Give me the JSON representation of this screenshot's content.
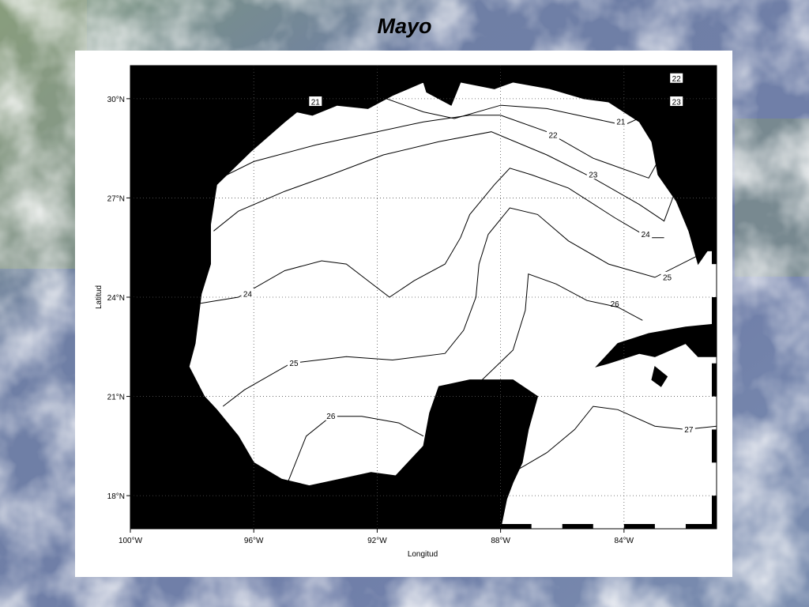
{
  "title": "Mayo",
  "colors": {
    "land": "#000000",
    "sea": "#ffffff",
    "contour": "#000000",
    "grid": "#555555"
  },
  "map": {
    "xlabel": "Longitud",
    "ylabel": "Latitud",
    "lon_range": [
      -100,
      -81
    ],
    "lat_range": [
      17,
      31
    ],
    "lon_ticks": [
      {
        "value": -100,
        "label": "100°W"
      },
      {
        "value": -96,
        "label": "96°W"
      },
      {
        "value": -92,
        "label": "92°W"
      },
      {
        "value": -88,
        "label": "88°W"
      },
      {
        "value": -84,
        "label": "84°W"
      }
    ],
    "lat_ticks": [
      {
        "value": 18,
        "label": "18°N"
      },
      {
        "value": 21,
        "label": "21°N"
      },
      {
        "value": 24,
        "label": "24°N"
      },
      {
        "value": 27,
        "label": "27°N"
      },
      {
        "value": 30,
        "label": "30°N"
      }
    ],
    "contours": [
      {
        "level": "21",
        "labels": [
          [
            -94.0,
            29.9
          ],
          [
            -84.1,
            29.3
          ]
        ],
        "points": [
          [
            -94.4,
            29.6
          ],
          [
            -93.5,
            29.8
          ],
          [
            -92.0,
            30.1
          ],
          [
            -90.5,
            29.6
          ],
          [
            -89.5,
            29.4
          ],
          [
            -88.0,
            29.8
          ],
          [
            -86.5,
            29.7
          ],
          [
            -85.5,
            29.5
          ],
          [
            -84.0,
            29.2
          ],
          [
            -83.3,
            29.5
          ]
        ]
      },
      {
        "level": "22",
        "labels": [
          [
            -86.3,
            28.9
          ],
          [
            -82.3,
            30.6
          ]
        ],
        "points": [
          [
            -97.3,
            27.5
          ],
          [
            -96.0,
            28.1
          ],
          [
            -94.0,
            28.6
          ],
          [
            -92.0,
            29.0
          ],
          [
            -90.5,
            29.3
          ],
          [
            -89.0,
            29.5
          ],
          [
            -88.0,
            29.5
          ],
          [
            -86.5,
            29.0
          ],
          [
            -85.0,
            28.2
          ],
          [
            -83.2,
            27.6
          ],
          [
            -81.3,
            30.8
          ]
        ]
      },
      {
        "level": "23",
        "labels": [
          [
            -85.0,
            27.7
          ],
          [
            -82.3,
            29.9
          ]
        ],
        "points": [
          [
            -97.3,
            26.0
          ],
          [
            -96.5,
            26.6
          ],
          [
            -95.0,
            27.2
          ],
          [
            -93.5,
            27.7
          ],
          [
            -91.8,
            28.3
          ],
          [
            -90.0,
            28.7
          ],
          [
            -88.3,
            29.0
          ],
          [
            -86.5,
            28.3
          ],
          [
            -85.0,
            27.6
          ],
          [
            -83.5,
            26.8
          ],
          [
            -82.7,
            26.3
          ],
          [
            -81.3,
            29.8
          ]
        ]
      },
      {
        "level": "24",
        "labels": [
          [
            -96.2,
            24.1
          ],
          [
            -83.3,
            25.9
          ]
        ],
        "points": [
          [
            -98.5,
            23.7
          ],
          [
            -96.5,
            24.0
          ],
          [
            -95.0,
            24.8
          ],
          [
            -93.8,
            25.1
          ],
          [
            -93.0,
            25.0
          ],
          [
            -92.3,
            24.5
          ],
          [
            -91.6,
            24.0
          ],
          [
            -90.8,
            24.5
          ],
          [
            -89.8,
            25.0
          ],
          [
            -89.3,
            25.8
          ],
          [
            -89.0,
            26.5
          ],
          [
            -88.2,
            27.4
          ],
          [
            -87.7,
            27.9
          ],
          [
            -87.0,
            27.7
          ],
          [
            -85.8,
            27.3
          ],
          [
            -84.3,
            26.4
          ],
          [
            -83.2,
            25.8
          ],
          [
            -82.7,
            25.8
          ]
        ]
      },
      {
        "level": "25",
        "labels": [
          [
            -94.7,
            22.0
          ],
          [
            -82.6,
            24.6
          ]
        ],
        "points": [
          [
            -97.0,
            20.7
          ],
          [
            -96.3,
            21.2
          ],
          [
            -94.8,
            22.0
          ],
          [
            -93.0,
            22.2
          ],
          [
            -91.5,
            22.1
          ],
          [
            -89.8,
            22.3
          ],
          [
            -89.2,
            23.0
          ],
          [
            -88.8,
            24.0
          ],
          [
            -88.7,
            25.0
          ],
          [
            -88.4,
            25.9
          ],
          [
            -87.7,
            26.7
          ],
          [
            -86.8,
            26.5
          ],
          [
            -85.8,
            25.7
          ],
          [
            -84.5,
            25.0
          ],
          [
            -83.0,
            24.6
          ],
          [
            -81.3,
            25.4
          ]
        ]
      },
      {
        "level": "26",
        "labels": [
          [
            -93.5,
            20.4
          ],
          [
            -84.3,
            23.8
          ]
        ],
        "points": [
          [
            -94.9,
            18.4
          ],
          [
            -94.3,
            19.8
          ],
          [
            -93.5,
            20.4
          ],
          [
            -92.5,
            20.4
          ],
          [
            -91.3,
            20.2
          ],
          [
            -90.5,
            19.8
          ]
        ]
      },
      {
        "level": "26",
        "labels": [],
        "points": [
          [
            -88.6,
            21.5
          ],
          [
            -87.6,
            22.4
          ],
          [
            -87.2,
            23.6
          ],
          [
            -87.1,
            24.7
          ],
          [
            -86.2,
            24.4
          ],
          [
            -85.2,
            23.9
          ],
          [
            -84.2,
            23.7
          ],
          [
            -83.4,
            23.3
          ]
        ]
      },
      {
        "level": "27",
        "labels": [
          [
            -81.9,
            20.0
          ]
        ],
        "points": [
          [
            -87.6,
            18.7
          ],
          [
            -86.5,
            19.3
          ],
          [
            -85.6,
            20.0
          ],
          [
            -85.0,
            20.7
          ],
          [
            -84.2,
            20.6
          ],
          [
            -83.0,
            20.1
          ],
          [
            -82.0,
            20.0
          ],
          [
            -81.0,
            20.1
          ]
        ]
      }
    ],
    "land": [
      [
        [
          -100.1,
          31.2
        ],
        [
          -80.9,
          31.2
        ],
        [
          -80.9,
          25.4
        ],
        [
          -81.3,
          25.4
        ],
        [
          -81.6,
          25.0
        ],
        [
          -81.9,
          26.0
        ],
        [
          -82.3,
          26.9
        ],
        [
          -82.9,
          27.7
        ],
        [
          -83.1,
          28.7
        ],
        [
          -83.5,
          29.3
        ],
        [
          -84.5,
          29.9
        ],
        [
          -85.3,
          30.0
        ],
        [
          -86.4,
          30.3
        ],
        [
          -87.6,
          30.5
        ],
        [
          -88.2,
          30.3
        ],
        [
          -89.3,
          30.5
        ],
        [
          -89.6,
          29.8
        ],
        [
          -90.4,
          30.2
        ],
        [
          -90.5,
          30.5
        ],
        [
          -91.5,
          30.1
        ],
        [
          -92.3,
          29.7
        ],
        [
          -93.3,
          29.8
        ],
        [
          -94.1,
          29.5
        ],
        [
          -94.6,
          29.6
        ],
        [
          -95.0,
          29.3
        ],
        [
          -96.1,
          28.4
        ],
        [
          -97.2,
          27.4
        ],
        [
          -97.4,
          26.2
        ],
        [
          -97.4,
          25.0
        ],
        [
          -97.7,
          24.1
        ],
        [
          -97.9,
          22.6
        ],
        [
          -98.1,
          21.9
        ],
        [
          -97.6,
          21.0
        ],
        [
          -97.2,
          20.6
        ],
        [
          -96.5,
          19.8
        ],
        [
          -96.0,
          19.0
        ],
        [
          -95.1,
          18.5
        ],
        [
          -94.2,
          18.3
        ],
        [
          -93.2,
          18.5
        ],
        [
          -92.2,
          18.7
        ],
        [
          -91.4,
          18.6
        ],
        [
          -90.5,
          19.5
        ],
        [
          -90.3,
          20.5
        ],
        [
          -90.0,
          21.3
        ],
        [
          -89.0,
          21.5
        ],
        [
          -87.6,
          21.5
        ],
        [
          -86.8,
          21.0
        ],
        [
          -87.1,
          20.0
        ],
        [
          -87.3,
          19.0
        ],
        [
          -87.6,
          18.4
        ],
        [
          -87.8,
          17.9
        ],
        [
          -88.0,
          17.0
        ],
        [
          -100.1,
          17.0
        ]
      ],
      [
        [
          -84.5,
          22.0
        ],
        [
          -84.9,
          21.9
        ],
        [
          -84.2,
          22.6
        ],
        [
          -83.2,
          22.9
        ],
        [
          -82.0,
          23.1
        ],
        [
          -80.9,
          23.2
        ],
        [
          -80.9,
          22.2
        ],
        [
          -81.6,
          22.2
        ],
        [
          -82.0,
          22.6
        ],
        [
          -83.0,
          22.2
        ],
        [
          -83.5,
          22.3
        ]
      ],
      [
        [
          -83.0,
          21.9
        ],
        [
          -82.6,
          21.6
        ],
        [
          -82.8,
          21.3
        ],
        [
          -83.1,
          21.5
        ]
      ]
    ]
  }
}
